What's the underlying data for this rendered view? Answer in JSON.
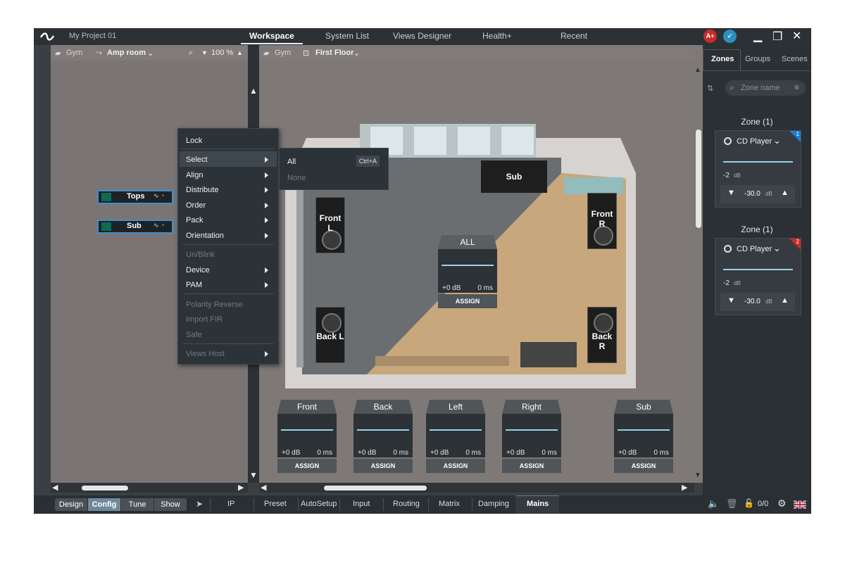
{
  "titlebar": {
    "project": "My Project 01",
    "tabs": [
      "Workspace",
      "System List",
      "Views Designer",
      "Health+",
      "Recent"
    ],
    "active_tab": "Workspace",
    "badge_a": "A+"
  },
  "left_panel": {
    "breadcrumb_root": "Gym",
    "breadcrumb_view": "Amp room",
    "zoom": "100 %",
    "devices": [
      "Tops",
      "Sub"
    ]
  },
  "canvas": {
    "breadcrumb_root": "Gym",
    "breadcrumb_floor": "First Floor"
  },
  "context_menu": {
    "items": [
      {
        "label": "Lock",
        "enabled": true,
        "submenu": false
      },
      {
        "label": "Select",
        "enabled": true,
        "submenu": true
      },
      {
        "label": "Align",
        "enabled": true,
        "submenu": true
      },
      {
        "label": "Distribute",
        "enabled": true,
        "submenu": true
      },
      {
        "label": "Order",
        "enabled": true,
        "submenu": true
      },
      {
        "label": "Pack",
        "enabled": true,
        "submenu": true
      },
      {
        "label": "Orientation",
        "enabled": true,
        "submenu": true
      },
      {
        "label": "Un/Blink",
        "enabled": false,
        "submenu": false
      },
      {
        "label": "Device",
        "enabled": true,
        "submenu": true
      },
      {
        "label": "PAM",
        "enabled": true,
        "submenu": true
      },
      {
        "label": "Polarity Reverse",
        "enabled": false,
        "submenu": false
      },
      {
        "label": "Import FIR",
        "enabled": false,
        "submenu": false
      },
      {
        "label": "Safe",
        "enabled": false,
        "submenu": false
      },
      {
        "label": "Views Host",
        "enabled": false,
        "submenu": true
      }
    ],
    "submenu": {
      "all": "All",
      "all_shortcut": "Ctrl+A",
      "none": "None"
    }
  },
  "room": {
    "speakers": {
      "front_l": "Front L",
      "front_r": "Front R",
      "back_l": "Back L",
      "back_r": "Back R",
      "sub": "Sub"
    },
    "all_fader": {
      "label": "ALL",
      "gain": "+0 dB",
      "delay": "0 ms",
      "assign": "ASSIGN"
    }
  },
  "faders": [
    {
      "label": "Front",
      "gain": "+0 dB",
      "delay": "0 ms",
      "assign": "ASSIGN"
    },
    {
      "label": "Back",
      "gain": "+0 dB",
      "delay": "0 ms",
      "assign": "ASSIGN"
    },
    {
      "label": "Left",
      "gain": "+0 dB",
      "delay": "0 ms",
      "assign": "ASSIGN"
    },
    {
      "label": "Right",
      "gain": "+0 dB",
      "delay": "0 ms",
      "assign": "ASSIGN"
    },
    {
      "label": "Sub",
      "gain": "+0 dB",
      "delay": "0 ms",
      "assign": "ASSIGN"
    }
  ],
  "right_panel": {
    "tabs": [
      "Zones",
      "Groups",
      "Scenes"
    ],
    "active_tab": "Zones",
    "search_placeholder": "Zone name",
    "zones": [
      {
        "title": "Zone (1)",
        "source": "CD Player",
        "level": "-2",
        "level_unit": "dB",
        "volume": "-30.0",
        "volume_unit": "dB",
        "badge": "1",
        "badge_color": "#1e7fd0"
      },
      {
        "title": "Zone (1)",
        "source": "CD Player",
        "level": "-2",
        "level_unit": "dB",
        "volume": "-30.0",
        "volume_unit": "dB",
        "badge": "2",
        "badge_color": "#c92a2a"
      }
    ]
  },
  "statusbar": {
    "modes": [
      "Design",
      "Config",
      "Tune",
      "Show"
    ],
    "active_mode": "Config",
    "tabs": [
      "IP",
      "Preset",
      "AutoSetup",
      "Input",
      "Routing",
      "Matrix",
      "Damping",
      "Mains"
    ],
    "active_tab": "Mains",
    "counter": "0/0"
  }
}
